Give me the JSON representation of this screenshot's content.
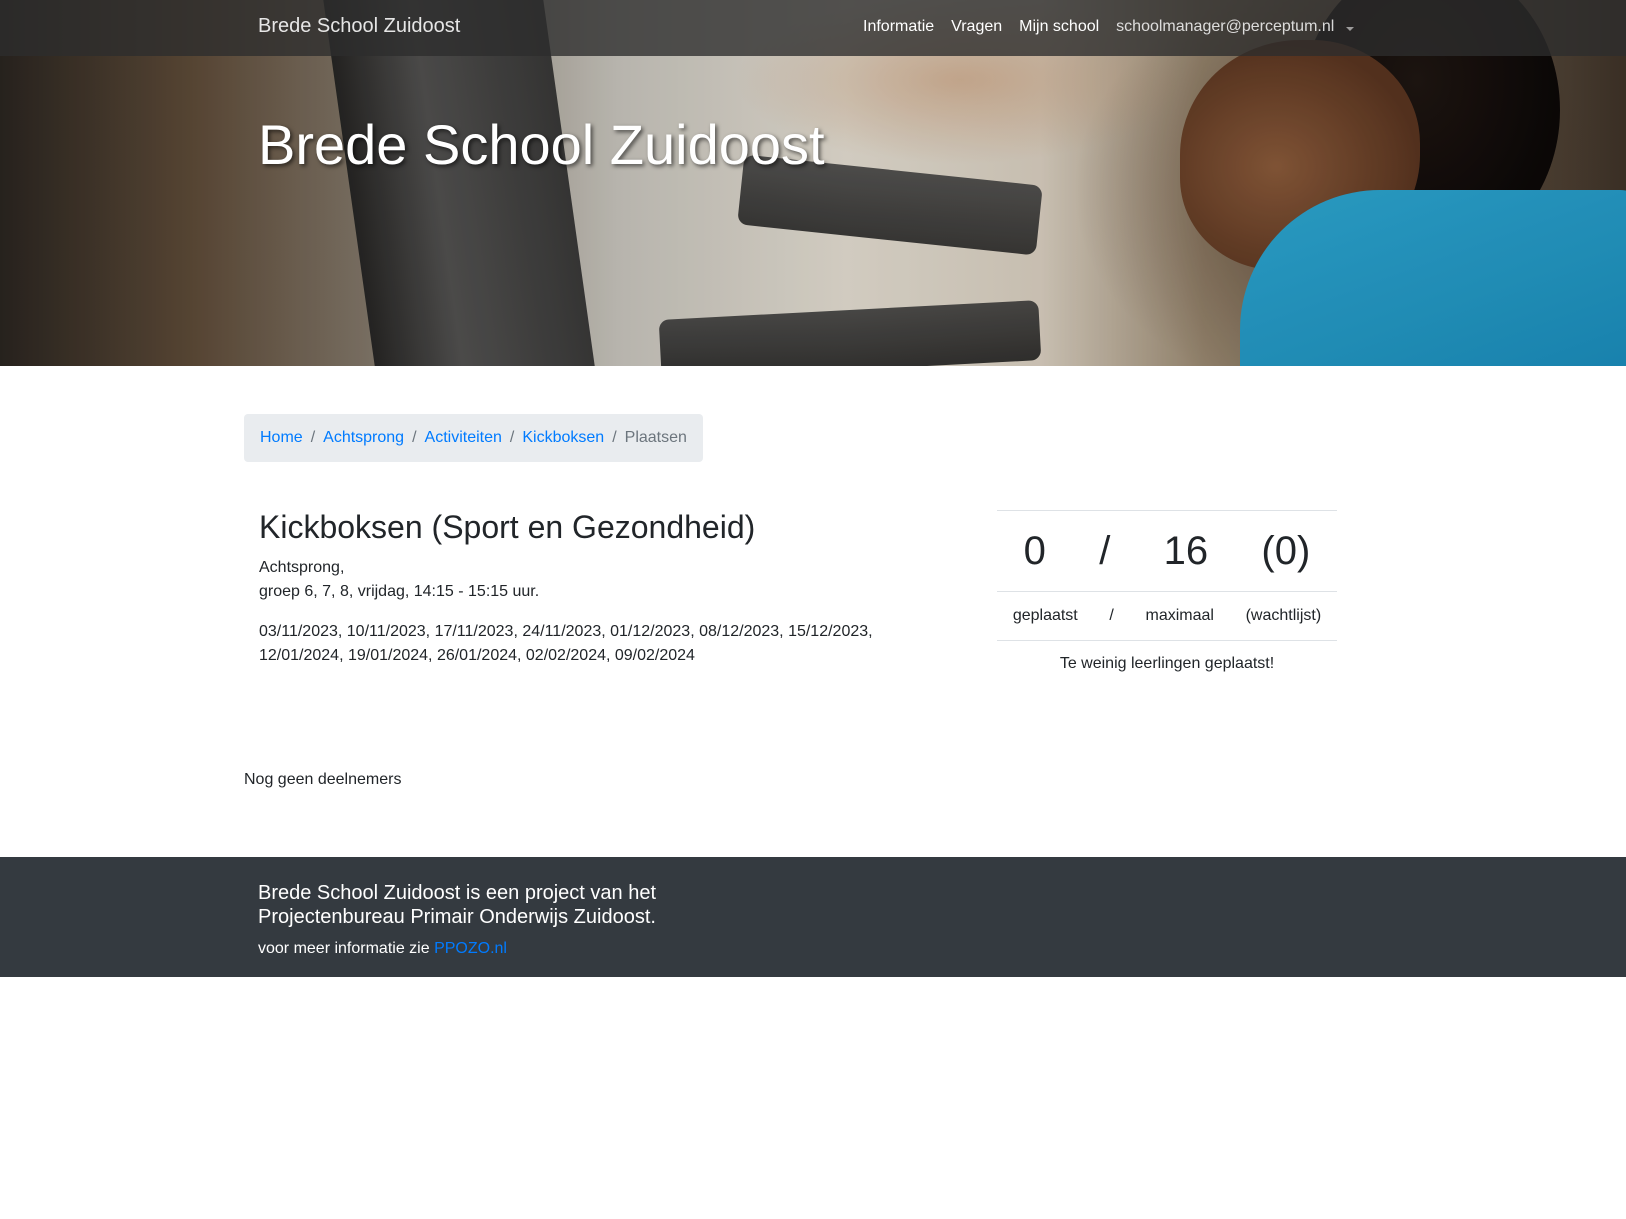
{
  "navbar": {
    "brand": "Brede School Zuidoost",
    "links": [
      "Informatie",
      "Vragen",
      "Mijn school"
    ],
    "user": "schoolmanager@perceptum.nl"
  },
  "hero": {
    "title": "Brede School Zuidoost"
  },
  "breadcrumb": {
    "items": [
      "Home",
      "Achtsprong",
      "Activiteiten",
      "Kickboksen"
    ],
    "active": "Plaatsen",
    "separator": "/"
  },
  "activity": {
    "title": "Kickboksen (Sport en Gezondheid)",
    "location": "Achtsprong,",
    "schedule": "groep 6, 7, 8, vrijdag, 14:15 - 15:15 uur.",
    "dates": "03/11/2023, 10/11/2023, 17/11/2023, 24/11/2023, 01/12/2023, 08/12/2023, 15/12/2023, 12/01/2024, 19/01/2024, 26/01/2024, 02/02/2024, 09/02/2024"
  },
  "stats": {
    "placed": "0",
    "slash": "/",
    "maximum": "16",
    "waitlist": "(0)",
    "placed_label": "geplaatst",
    "maximum_label": "maximaal",
    "waitlist_label": "(wachtlijst)",
    "message": "Te weinig leerlingen geplaatst!"
  },
  "participants": {
    "empty_text": "Nog geen deelnemers"
  },
  "footer": {
    "tagline": "Brede School Zuidoost is een project van het Projectenbureau Primair Onderwijs Zuidoost.",
    "more_info": "voor meer informatie zie ",
    "link": "PPOZO.nl"
  },
  "colors": {
    "link": "#007bff",
    "footer_bg": "#343a40",
    "breadcrumb_bg": "#e9ecef"
  }
}
